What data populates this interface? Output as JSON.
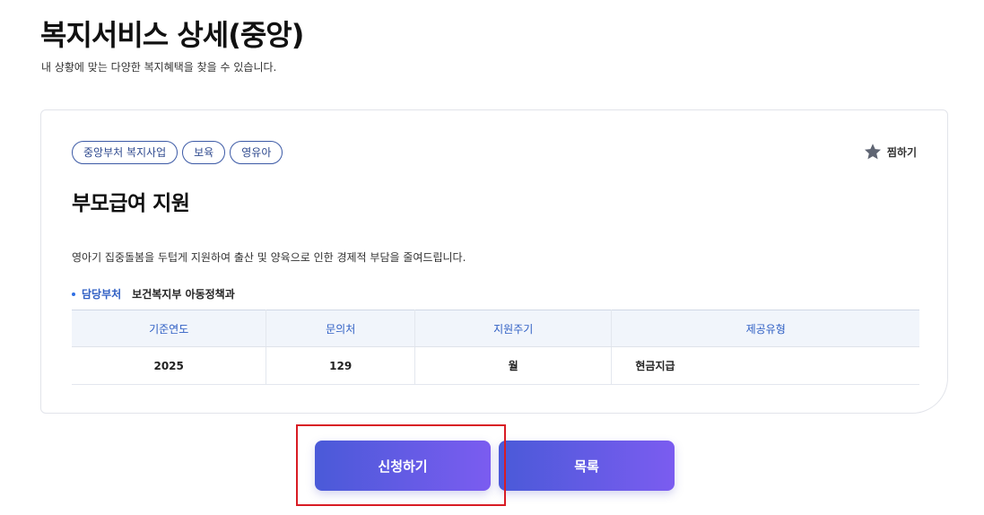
{
  "header": {
    "title": "복지서비스 상세(중앙)",
    "subtitle": "내 상황에 맞는 다양한 복지혜택을 찾을 수 있습니다."
  },
  "service": {
    "tags": [
      "중앙부처 복지사업",
      "보육",
      "영유아"
    ],
    "favorite_label": "찜하기",
    "favorite_icon": "star-icon",
    "title": "부모급여 지원",
    "description": "영아기 집중돌봄을 두텁게 지원하여 출산 및 양육으로 인한 경제적 부담을 줄여드립니다.",
    "department_label": "담당부처",
    "department_value": "보건복지부 아동정책과"
  },
  "info_table": {
    "headers": [
      "기준연도",
      "문의처",
      "지원주기",
      "제공유형"
    ],
    "row": [
      "2025",
      "129",
      "월",
      "현금지급"
    ]
  },
  "actions": {
    "apply_label": "신청하기",
    "list_label": "목록"
  },
  "colors": {
    "accent": "#2f5fc4",
    "button_gradient_start": "#4a5ad8",
    "button_gradient_end": "#7b5cf0",
    "highlight": "#d81c24"
  }
}
